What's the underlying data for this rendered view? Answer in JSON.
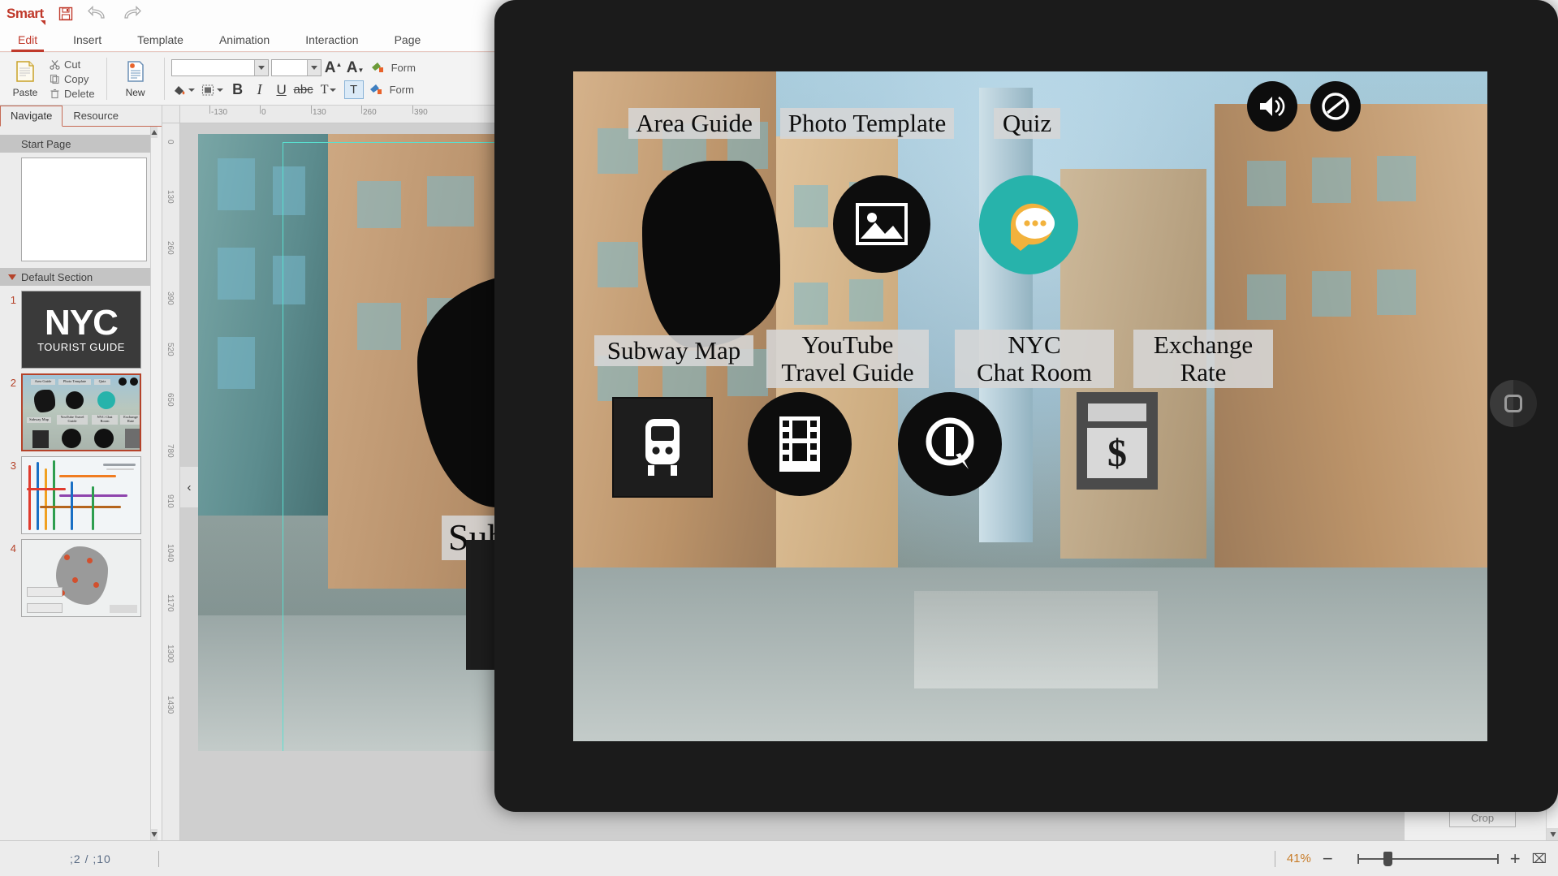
{
  "app": {
    "brand": "Smart",
    "quick_actions": [
      {
        "name": "save-icon",
        "label": "Save"
      },
      {
        "name": "undo-icon",
        "label": "Undo"
      },
      {
        "name": "redo-icon",
        "label": "Redo"
      }
    ]
  },
  "ribbon": {
    "tabs": [
      {
        "label": "Edit",
        "active": true
      },
      {
        "label": "Insert",
        "active": false
      },
      {
        "label": "Template",
        "active": false
      },
      {
        "label": "Animation",
        "active": false
      },
      {
        "label": "Interaction",
        "active": false
      },
      {
        "label": "Page",
        "active": false
      }
    ],
    "clipboard": {
      "paste_label": "Paste",
      "cut_label": "Cut",
      "copy_label": "Copy",
      "delete_label": "Delete"
    },
    "page_group": {
      "new_label": "New"
    },
    "font": {
      "family_value": "",
      "family_placeholder": "",
      "size_value": "",
      "size_placeholder": "",
      "grow_label": "A",
      "shrink_label": "A",
      "bold_label": "B",
      "italic_label": "I",
      "underline_label": "U",
      "strike_label": "abc",
      "color_label": "T",
      "highlight_label": "T",
      "format1_label": "Form",
      "format2_label": "Form"
    }
  },
  "left_panel": {
    "tabs": [
      {
        "label": "Navigate",
        "active": true
      },
      {
        "label": "Resource",
        "active": false
      }
    ],
    "start_section_label": "Start Page",
    "default_section_label": "Default Section",
    "slides": [
      {
        "number": "1",
        "name": "NYC Tourist Guide",
        "title_main": "NYC",
        "title_sub": "TOURIST GUIDE",
        "selected": false
      },
      {
        "number": "2",
        "name": "Main Menu",
        "selected": true
      },
      {
        "number": "3",
        "name": "Subway Map",
        "selected": false
      },
      {
        "number": "4",
        "name": "Area Map",
        "selected": false
      }
    ]
  },
  "rulers": {
    "horizontal_ticks": [
      "-130",
      "0",
      "130",
      "260",
      "390"
    ],
    "vertical_ticks": [
      "0",
      "130",
      "260",
      "390",
      "520",
      "650",
      "780",
      "910",
      "1040",
      "1170",
      "1300",
      "1430"
    ]
  },
  "canvas": {
    "collapse_label": "‹",
    "slide_labels": [
      {
        "text": "Area Guide"
      },
      {
        "text": "Subway Map"
      }
    ]
  },
  "preview": {
    "top_controls": [
      {
        "name": "sound-icon",
        "label": "Sound"
      },
      {
        "name": "no-entry-icon",
        "label": "Disable"
      }
    ],
    "labels_top": [
      {
        "text": "Area Guide"
      },
      {
        "text": "Photo Template"
      },
      {
        "text": "Quiz"
      }
    ],
    "labels_bottom": [
      {
        "text": "Subway Map"
      },
      {
        "text": "YouTube\nTravel Guide"
      },
      {
        "text": "NYC\nChat Room"
      },
      {
        "text": "Exchange\nRate"
      }
    ],
    "icons": [
      {
        "name": "photo-template-icon",
        "label": "Photo Template"
      },
      {
        "name": "quiz-chat-icon",
        "label": "Quiz"
      },
      {
        "name": "subway-train-icon",
        "label": "Subway Map"
      },
      {
        "name": "film-strip-icon",
        "label": "YouTube Travel Guide"
      },
      {
        "name": "chat-bubble-icon",
        "label": "NYC Chat Room"
      },
      {
        "name": "dollar-sign-icon",
        "label": "Exchange Rate"
      }
    ],
    "home_button_label": "Home"
  },
  "right_panel": {
    "crop_label": "Crop"
  },
  "status": {
    "page_indicator": ";2  /  ;10",
    "zoom_value": "41%",
    "zoom_out_label": "−",
    "zoom_in_label": "+",
    "fit_label": "⌧"
  },
  "colors": {
    "accent": "#c0392b",
    "tab_active": "#c0392b",
    "thumb_selected_border": "#b5432a",
    "zoom_text": "#c87c28",
    "teal_icon": "#27b3ab",
    "selection_outline": "#59e0d0"
  }
}
